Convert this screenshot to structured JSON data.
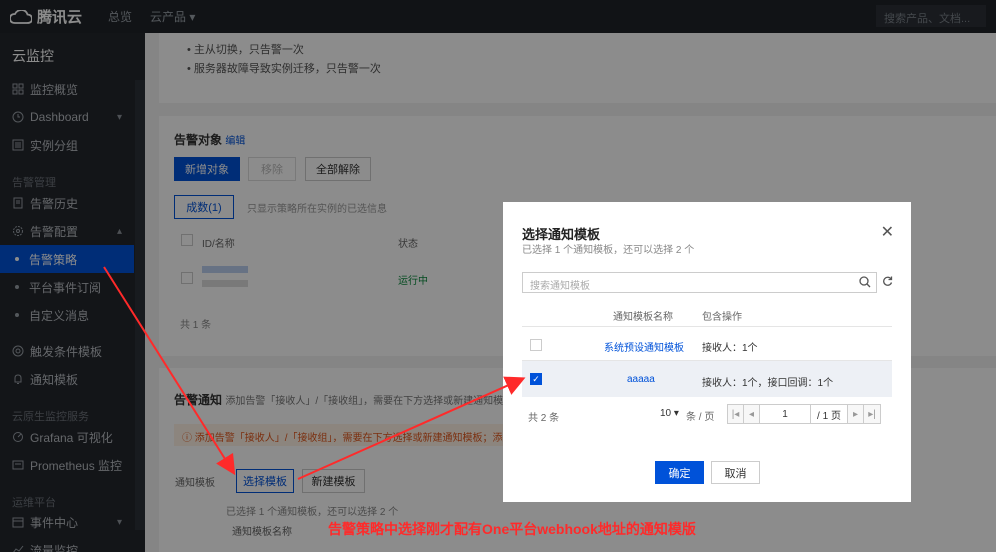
{
  "topnav": {
    "brand": "腾讯云",
    "links": [
      "总览",
      "云产品 ▾"
    ],
    "search_placeholder": "搜索产品、文档..."
  },
  "sidebar": {
    "title": "云监控",
    "items": [
      {
        "label": "监控概览",
        "icon": "grid-icon"
      },
      {
        "label": "Dashboard",
        "icon": "clock-icon",
        "chevron": "▾"
      },
      {
        "label": "实例分组",
        "icon": "list-icon"
      }
    ],
    "section_alarm": "告警管理",
    "alarm_items": [
      {
        "label": "告警历史",
        "icon": "doc-icon"
      },
      {
        "label": "告警配置",
        "icon": "gear-icon",
        "chevron": "▴"
      }
    ],
    "sub_items": [
      "告警策略",
      "平台事件订阅",
      "自定义消息"
    ],
    "more_items": [
      {
        "label": "触发条件模板",
        "icon": "target-icon"
      },
      {
        "label": "通知模板",
        "icon": "bell-icon"
      }
    ],
    "section_cloud": "云原生监控服务",
    "cloud_items": [
      {
        "label": "Grafana 可视化",
        "icon": "grafana-icon"
      },
      {
        "label": "Prometheus 监控",
        "icon": "prom-icon"
      }
    ],
    "section_platform": "运维平台",
    "platform_items": [
      {
        "label": "事件中心",
        "icon": "event-icon",
        "chevron": "▾"
      },
      {
        "label": "流量监控",
        "icon": "flow-icon"
      }
    ]
  },
  "main": {
    "bullets": [
      "主从切换，只告警一次",
      "服务器故障导致实例迁移，只告警一次"
    ],
    "alarm_object_title": "告警对象",
    "alarm_object_edit": "编辑",
    "btn_new_object": "新增对象",
    "btn_remove": "移除",
    "btn_remove_all": "全部解除",
    "btn_filter": "成数(1)",
    "filter_hint": "只显示策略所在实例的已选信息",
    "col_instance": "ID/名称",
    "col_status": "状态",
    "status_running": "运行中",
    "total_text": "共 1 条",
    "alarm_notify_title": "告警通知",
    "alarm_notify_desc": "添加告警「接收人」/「接收组」，需要在下方选择或新建通知模板",
    "warning_text": "添加告警「接收人」/「接收组」，需要在下方选择或新建通知模板；添加",
    "notify_label": "通知模板",
    "btn_select_template": "选择模板",
    "btn_new_template": "新建模板",
    "selected_hint": "已选择 1 个通知模板，还可以选择 2 个",
    "col_template_name": "通知模板名称"
  },
  "modal": {
    "title": "选择通知模板",
    "subtitle": "已选择 1 个通知模板，还可以选择 2 个",
    "search_placeholder": "搜索通知模板",
    "col_name": "通知模板名称",
    "col_ops": "包含操作",
    "rows": [
      {
        "name": "系统预设通知模板",
        "ops": "接收人：1个",
        "checked": false
      },
      {
        "name": "aaaaa",
        "ops": "接收人：1个，接口回调：1个",
        "checked": true
      }
    ],
    "total": "共 2 条",
    "page_size": "10 ▾",
    "page_size_unit": "条 / 页",
    "page_current": "1",
    "page_total": "/ 1 页",
    "btn_confirm": "确定",
    "btn_cancel": "取消"
  },
  "annotation": "告警策略中选择刚才配有One平台webhook地址的通知模版",
  "colors": {
    "brand": "#0052d9",
    "annotation": "#ff2a2a",
    "sidebar_bg": "#23272d"
  }
}
